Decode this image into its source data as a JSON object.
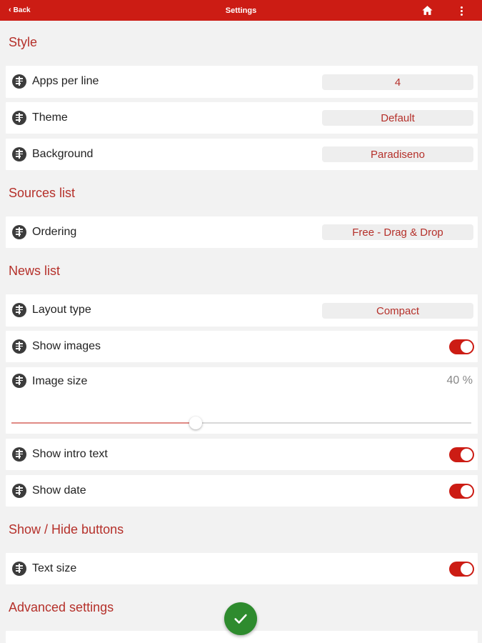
{
  "header": {
    "back_label": "Back",
    "title": "Settings",
    "icons": [
      "chevron-left-icon",
      "home-icon",
      "more-vert-icon"
    ]
  },
  "colors": {
    "accent": "#cc1c14",
    "heading": "#b5302a",
    "fab": "#2e8b2e",
    "background": "#f2f2f2"
  },
  "sections": {
    "style": {
      "title": "Style",
      "apps_per_line": {
        "label": "Apps per line",
        "value": "4"
      },
      "theme": {
        "label": "Theme",
        "value": "Default"
      },
      "background": {
        "label": "Background",
        "value": "Paradiseno"
      }
    },
    "sources": {
      "title": "Sources list",
      "ordering": {
        "label": "Ordering",
        "value": "Free - Drag & Drop"
      }
    },
    "news": {
      "title": "News list",
      "layout_type": {
        "label": "Layout type",
        "value": "Compact"
      },
      "show_images": {
        "label": "Show images",
        "on": true
      },
      "image_size": {
        "label": "Image size",
        "value_text": "40 %",
        "fraction": 0.4
      },
      "show_intro_text": {
        "label": "Show intro text",
        "on": true
      },
      "show_date": {
        "label": "Show date",
        "on": true
      }
    },
    "buttons": {
      "title": "Show / Hide buttons",
      "text_size": {
        "label": "Text size",
        "on": true
      }
    },
    "advanced": {
      "title": "Advanced settings"
    }
  },
  "fab": {
    "icon": "check-icon"
  }
}
